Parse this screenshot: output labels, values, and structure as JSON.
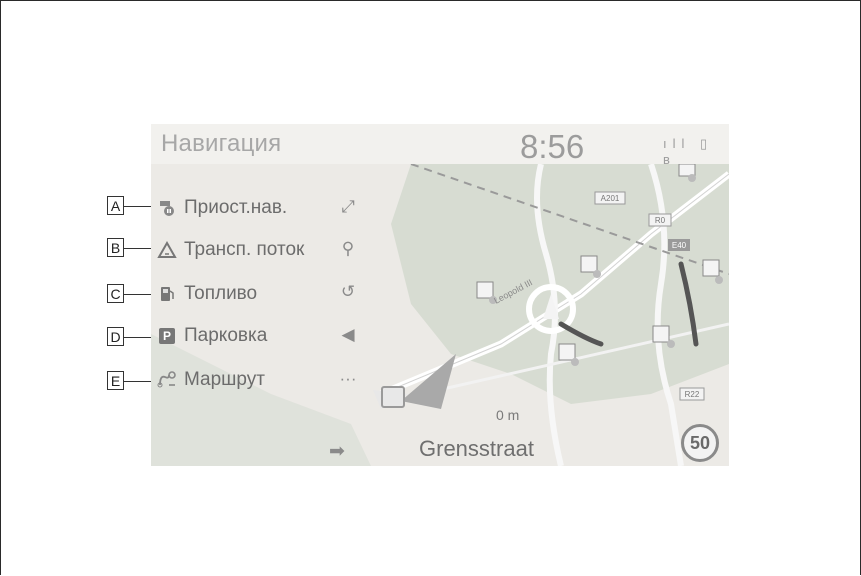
{
  "header": {
    "title": "Навигация",
    "clock": "8:56",
    "status_icons": [
      "signal-icon",
      "battery-icon",
      "bluetooth-icon"
    ],
    "status_glyphs": "ıll ▯ ʙ"
  },
  "menu": {
    "items": [
      {
        "callout": "A",
        "label": "Приост.нав.",
        "icon": "pause-guidance-icon"
      },
      {
        "callout": "B",
        "label": "Трансп. поток",
        "icon": "traffic-icon"
      },
      {
        "callout": "C",
        "label": "Топливо",
        "icon": "fuel-icon"
      },
      {
        "callout": "D",
        "label": "Парковка",
        "icon": "parking-icon"
      },
      {
        "callout": "E",
        "label": "Маршрут",
        "icon": "route-icon"
      }
    ],
    "parking_glyph": "P"
  },
  "side_buttons": [
    {
      "name": "fullscreen-icon",
      "glyph": "⤢"
    },
    {
      "name": "search-icon",
      "glyph": "⚲"
    },
    {
      "name": "reroute-icon",
      "glyph": "↺"
    },
    {
      "name": "volume-icon",
      "glyph": "◀"
    },
    {
      "name": "more-icon",
      "glyph": "···"
    }
  ],
  "map": {
    "road_labels": [
      "A201",
      "R0",
      "E40",
      "R22",
      "Leopold III"
    ],
    "route_color": "#555555"
  },
  "guidance": {
    "distance": "0 m",
    "street": "Grensstraat",
    "turn_glyph": "➡",
    "speed_limit": "50"
  }
}
